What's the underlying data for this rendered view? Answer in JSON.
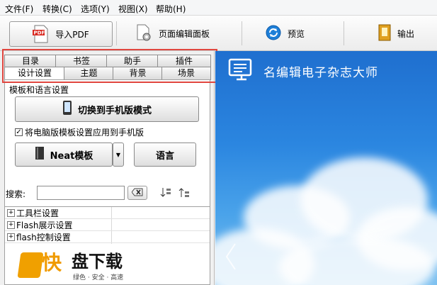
{
  "menu": [
    "文件(F)",
    "转换(C)",
    "选项(Y)",
    "视图(X)",
    "帮助(H)"
  ],
  "toolbar": {
    "import_pdf": "导入PDF",
    "page_edit_panel": "页面编辑面板",
    "preview": "预览",
    "output": "输出",
    "pdf_badge": "PDF"
  },
  "tabs_top": [
    "目录",
    "书签",
    "助手",
    "插件"
  ],
  "tabs_bottom": [
    "设计设置",
    "主题",
    "背景",
    "场景"
  ],
  "section_template_lang": "模板和语言设置",
  "switch_mobile_label": "切换到手机版模式",
  "apply_pc_to_mobile": "将电脑版模板设置应用到手机版",
  "apply_checked": true,
  "neat_template_label": "Neat模板",
  "language_label": "语言",
  "search_label": "搜索:",
  "tree_items": [
    "工具栏设置",
    "Flash展示设置",
    "flash控制设置"
  ],
  "brand_title": "名编辑电子杂志大师",
  "watermark": {
    "logo_main": "快",
    "logo_text": "盘下载",
    "logo_sub": "绿色 · 安全 · 高速"
  },
  "colors": {
    "highlight_frame": "#e0463f",
    "sky": "#2b86e0"
  }
}
